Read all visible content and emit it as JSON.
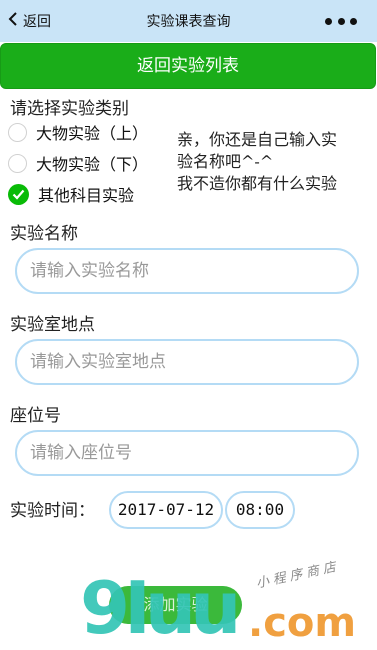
{
  "nav": {
    "back_label": "返回",
    "title": "实验课表查询"
  },
  "return_button": "返回实验列表",
  "type_section": {
    "label": "请选择实验类别",
    "options": [
      {
        "label": "大物实验（上）",
        "checked": false
      },
      {
        "label": "大物实验（下）",
        "checked": false
      },
      {
        "label": "其他科目实验",
        "checked": true
      }
    ],
    "tip_lines": [
      "亲，你还是自己输入实",
      "验名称吧^-^",
      "我不造你都有什么实验"
    ]
  },
  "name_field": {
    "label": "实验名称",
    "placeholder": "请输入实验名称",
    "value": ""
  },
  "location_field": {
    "label": "实验室地点",
    "placeholder": "请输入实验室地点",
    "value": ""
  },
  "seat_field": {
    "label": "座位号",
    "placeholder": "请输入座位号",
    "value": ""
  },
  "time_section": {
    "label": "实验时间：",
    "date": "2017-07-12",
    "time": "08:00"
  },
  "add_button": "添加实验",
  "watermark": {
    "letters": "9Iuu",
    "suffix": ".com",
    "caption": "小程序商店"
  },
  "colors": {
    "nav_bg": "#c9e4f7",
    "primary_green": "#1aad19",
    "input_border": "#b4dbf5",
    "check_green": "#09bb07"
  }
}
